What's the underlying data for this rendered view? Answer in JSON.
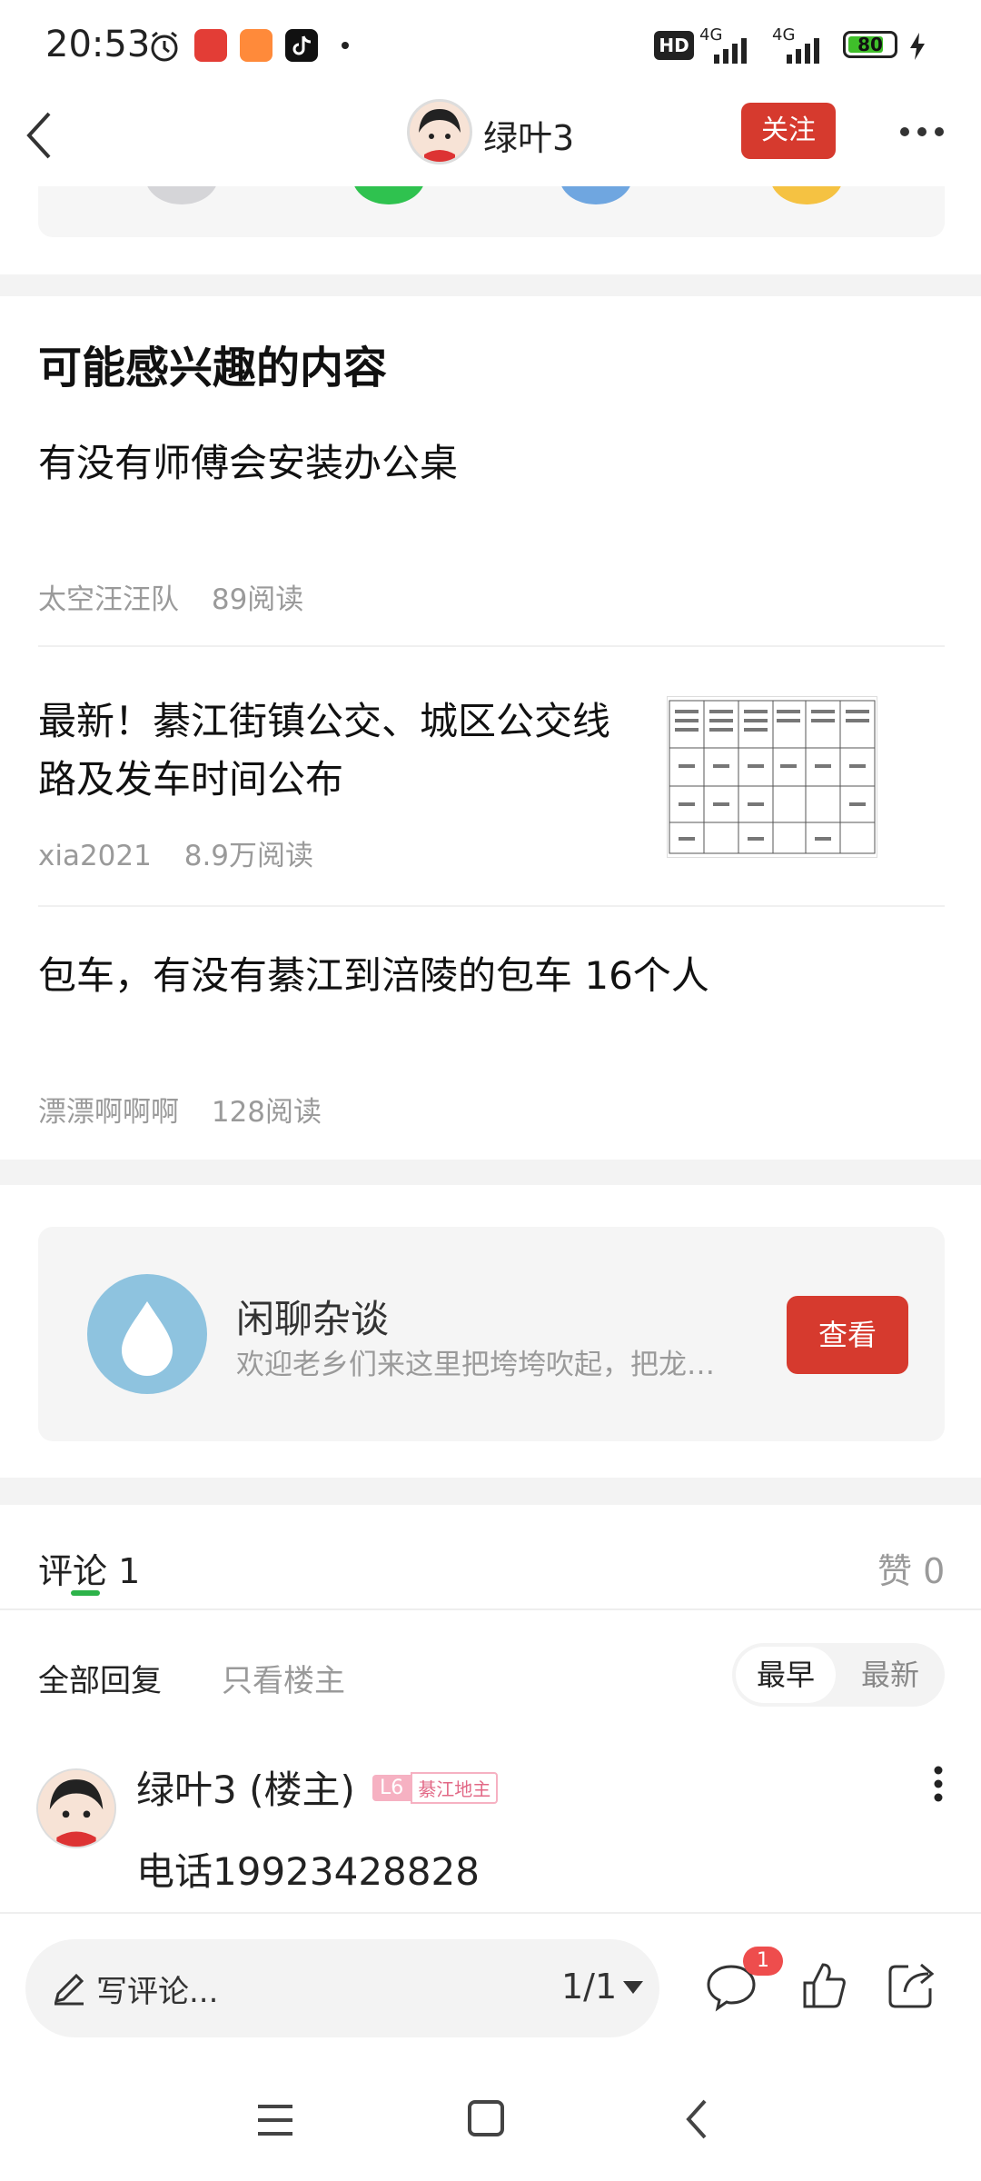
{
  "status_bar": {
    "time": "20:53",
    "network_label": "HD",
    "signal_1": "4G",
    "signal_2": "4G",
    "battery": "80",
    "battery_level": 0.8
  },
  "header": {
    "username": "绿叶3",
    "follow_label": "关注"
  },
  "recommend": {
    "title": "可能感兴趣的内容",
    "items": [
      {
        "title": "有没有师傅会安装办公桌",
        "author": "太空汪汪队",
        "reads": "89阅读"
      },
      {
        "title_line1": "最新！綦江街镇公交、城区公交线",
        "title_line2": "路及发车时间公布",
        "author": "xia2021",
        "reads": "8.9万阅读",
        "thumbnail": "bus-schedule-table-image"
      },
      {
        "title": "包车，有没有綦江到涪陵的包车 16个人",
        "author": "漂漂啊啊啊",
        "reads": "128阅读"
      }
    ]
  },
  "circle": {
    "name": "闲聊杂谈",
    "description": "欢迎老乡们来这里把垮垮吹起，把龙…",
    "button_label": "查看"
  },
  "comments": {
    "tab_label": "评论 1",
    "likes_label": "赞 0",
    "filter_all": "全部回复",
    "filter_author": "只看楼主",
    "sort_earliest": "最早",
    "sort_latest": "最新",
    "first": {
      "author": "绿叶3 (楼主)",
      "level": "L6",
      "title_badge": "綦江地主",
      "content": "电话19923428828"
    }
  },
  "bottom_bar": {
    "input_placeholder": "写评论...",
    "page": "1/1",
    "comment_badge": "1"
  },
  "colors": {
    "accent_red": "#d63a2e",
    "tab_green": "#2db34a",
    "meta_gray": "#9a9a9a"
  }
}
